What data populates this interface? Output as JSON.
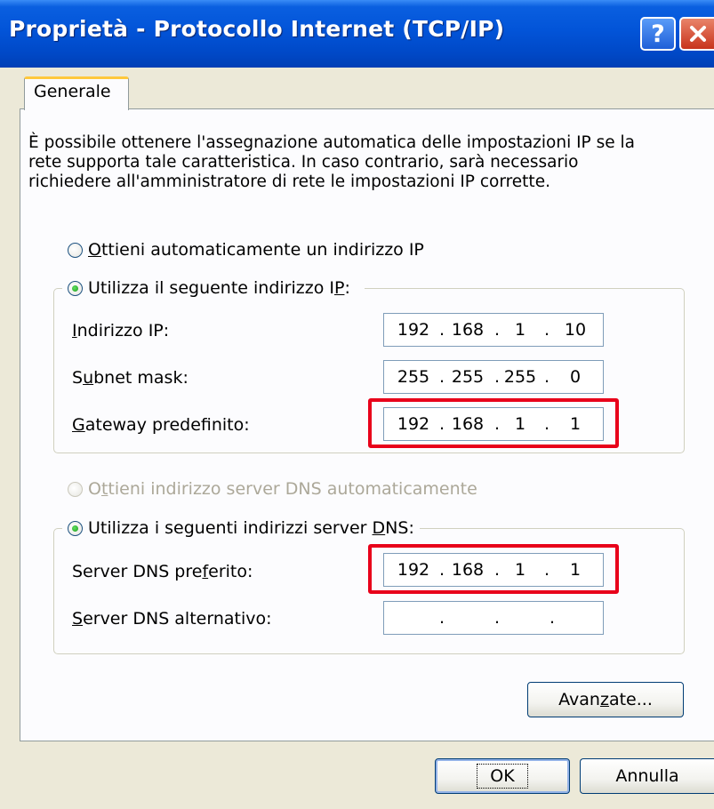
{
  "window": {
    "title": "Proprietà - Protocollo Internet (TCP/IP)",
    "help_label": "?",
    "close_label": "X"
  },
  "tabs": [
    {
      "label": "Generale",
      "selected": true
    }
  ],
  "description": [
    "È possibile ottenere l'assegnazione automatica delle impostazioni IP se la",
    "rete supporta tale caratteristica. In caso contrario, sarà necessario",
    "richiedere all'amministratore di rete le impostazioni IP corrette."
  ],
  "ip_section": {
    "auto_option": {
      "pre": "",
      "mnemonic": "O",
      "post": "ttieni automaticamente un indirizzo IP",
      "checked": false
    },
    "manual_option": {
      "pre": "Utilizza il seguente indirizzo I",
      "mnemonic": "P",
      "post": ":",
      "checked": true
    },
    "fields": [
      {
        "pre": "",
        "mnemonic": "I",
        "post": "ndirizzo IP:",
        "octets": [
          "192",
          "168",
          "1",
          "10"
        ],
        "highlighted": false
      },
      {
        "pre": "S",
        "mnemonic": "u",
        "post": "bnet mask:",
        "octets": [
          "255",
          "255",
          "255",
          "0"
        ],
        "highlighted": false
      },
      {
        "pre": "",
        "mnemonic": "G",
        "post": "ateway predefinito:",
        "octets": [
          "192",
          "168",
          "1",
          "1"
        ],
        "highlighted": true
      }
    ]
  },
  "dns_section": {
    "auto_option": {
      "pre": "O",
      "mnemonic": "t",
      "post": "tieni indirizzo server DNS automaticamente",
      "checked": false,
      "disabled": true
    },
    "manual_option": {
      "pre": "Utilizza i seguenti indirizzi server ",
      "mnemonic": "D",
      "post": "NS:",
      "checked": true
    },
    "fields": [
      {
        "pre": "Server DNS pre",
        "mnemonic": "f",
        "post": "erito:",
        "octets": [
          "192",
          "168",
          "1",
          "1"
        ],
        "highlighted": true
      },
      {
        "pre": "",
        "mnemonic": "S",
        "post": "erver DNS alternativo:",
        "octets": [
          "",
          "",
          "",
          ""
        ],
        "highlighted": false
      }
    ]
  },
  "buttons": {
    "advanced": {
      "pre": "Avan",
      "mnemonic": "z",
      "post": "ate..."
    },
    "ok": "OK",
    "cancel": "Annulla"
  },
  "colors": {
    "titlebar": "#0254d8",
    "highlight": "#e8001a",
    "tab_accent": "#ffc83c",
    "dialog_bg": "#ece9d8"
  },
  "icons": [
    "help-icon",
    "close-icon",
    "radio-button-icon"
  ]
}
